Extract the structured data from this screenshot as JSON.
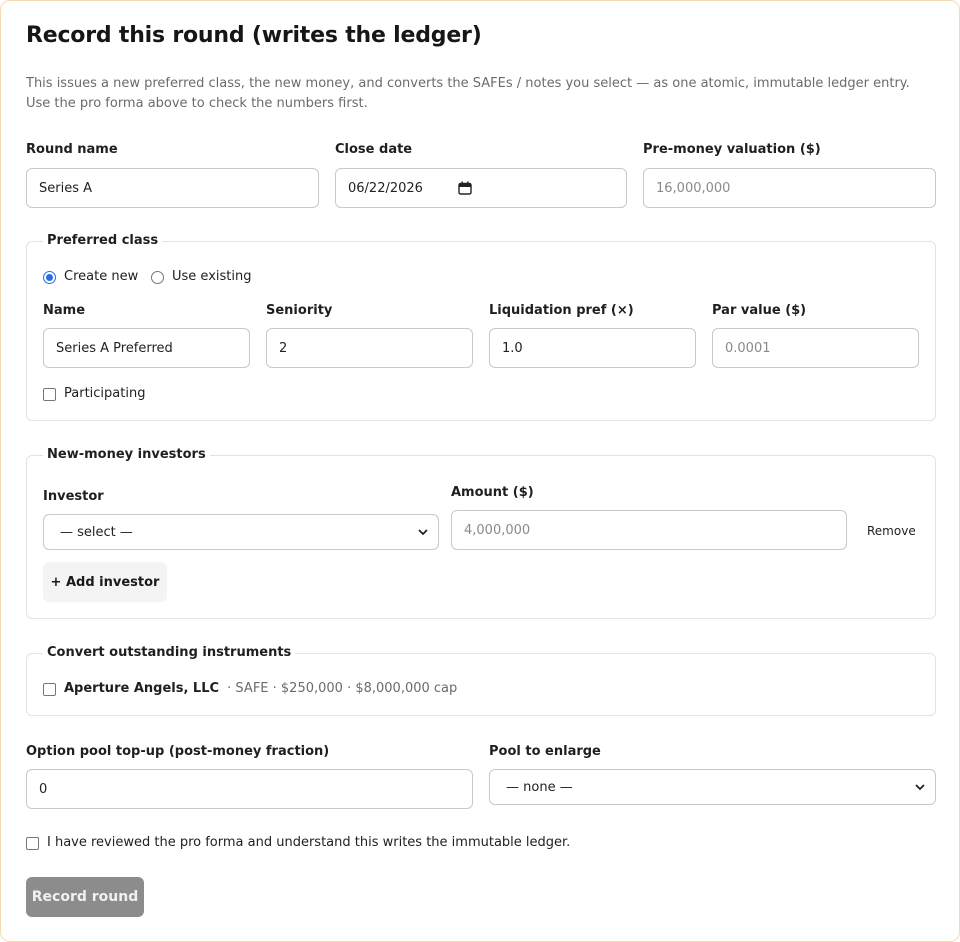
{
  "title": "Record this round (writes the ledger)",
  "description": "This issues a new preferred class, the new money, and converts the SAFEs / notes you select — as one atomic, immutable ledger entry. Use the pro forma above to check the numbers first.",
  "round": {
    "name_label": "Round name",
    "name_value": "Series A",
    "close_label": "Close date",
    "close_value": "06/22/2026",
    "premoney_label": "Pre-money valuation ($)",
    "premoney_placeholder": "16,000,000"
  },
  "preferred_class": {
    "legend": "Preferred class",
    "option_create": "Create new",
    "option_existing": "Use existing",
    "selected": "create",
    "name_label": "Name",
    "name_value": "Series A Preferred",
    "seniority_label": "Seniority",
    "seniority_value": "2",
    "liq_label": "Liquidation pref (×)",
    "liq_value": "1.0",
    "par_label": "Par value ($)",
    "par_placeholder": "0.0001",
    "participating_label": "Participating",
    "participating_checked": false
  },
  "investors": {
    "legend": "New-money investors",
    "investor_label": "Investor",
    "investor_select": "— select —",
    "amount_label": "Amount ($)",
    "amount_placeholder": "4,000,000",
    "remove_label": "Remove",
    "add_label": "+ Add investor"
  },
  "convert": {
    "legend": "Convert outstanding instruments",
    "items": [
      {
        "name": "Aperture Angels, LLC",
        "detail": "· SAFE · $250,000 · $8,000,000 cap",
        "checked": false
      }
    ]
  },
  "pool": {
    "topup_label": "Option pool top-up (post-money fraction)",
    "topup_value": "0",
    "enlarge_label": "Pool to enlarge",
    "enlarge_select": "— none —"
  },
  "confirm": {
    "label": "I have reviewed the pro forma and understand this writes the immutable ledger.",
    "checked": false
  },
  "submit_label": "Record round",
  "colors": {
    "accent": "#2b6fdb",
    "card_border": "#f3dcb4",
    "disabled_button": "#8c8c8c"
  }
}
